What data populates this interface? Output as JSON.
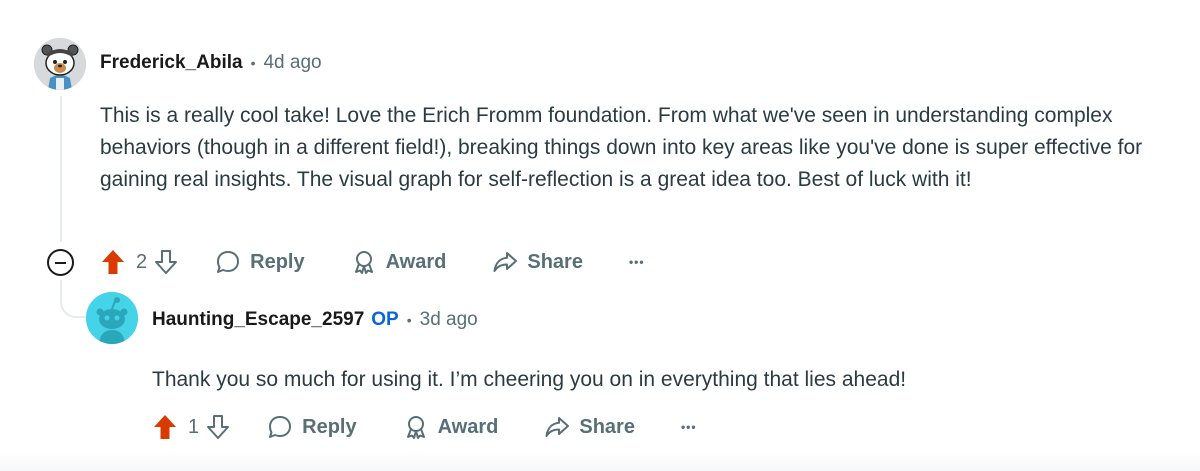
{
  "comments": [
    {
      "username": "Frederick_Abila",
      "separator": "•",
      "timestamp": "4d ago",
      "body": "This is a really cool take! Love the Erich Fromm foundation. From what we've seen in understanding complex behaviors (though in a different field!), breaking things down into key areas like you've done is super effective for gaining real insights. The visual graph for self-reflection is a great idea too. Best of luck with it!",
      "votes": "2",
      "actions": {
        "reply": "Reply",
        "award": "Award",
        "share": "Share",
        "more": "•••"
      }
    },
    {
      "username": "Haunting_Escape_2597",
      "badge": "OP",
      "separator": "•",
      "timestamp": "3d ago",
      "body": "Thank you so much for using it. I’m cheering you on in everything that lies ahead!",
      "votes": "1",
      "actions": {
        "reply": "Reply",
        "award": "Award",
        "share": "Share",
        "more": "•••"
      }
    }
  ],
  "colors": {
    "upvote_active": "#d93a00",
    "op_badge": "#0a66d8",
    "muted_text": "#576f76",
    "thread_line": "#e5ebee",
    "avatar_reply_bg": "#45d4e7"
  }
}
